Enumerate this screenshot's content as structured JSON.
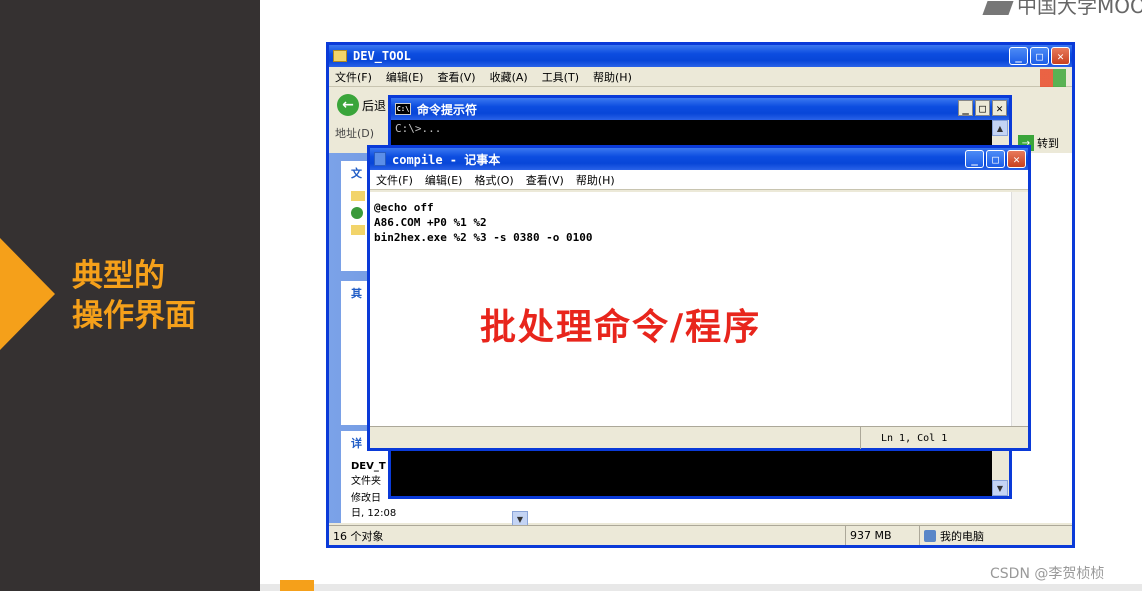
{
  "slide": {
    "heading_line1": "典型的",
    "heading_line2": "操作界面",
    "logo_text": "中国大学MOOC",
    "watermark": "CSDN @李贺桢桢",
    "accent_color": "#f5a01a"
  },
  "explorer": {
    "title": "DEV_TOOL",
    "menu": [
      "文件(F)",
      "编辑(E)",
      "查看(V)",
      "收藏(A)",
      "工具(T)",
      "帮助(H)"
    ],
    "back_label": "后退",
    "address_label": "地址(D)",
    "goto_label": "转到",
    "left_tasks": [
      "文",
      "其",
      "详"
    ],
    "details": {
      "name": "DEV_T",
      "type": "文件夹",
      "modified_label": "修改日",
      "modified_time": "日, 12:08"
    },
    "status": {
      "objects": "16 个对象",
      "size": "937 MB",
      "location": "我的电脑"
    }
  },
  "cmd": {
    "title": "命令提示符",
    "icon_text": "C:\\",
    "prompt": "C:\\>..."
  },
  "notepad": {
    "title": "compile - 记事本",
    "menu": [
      "文件(F)",
      "编辑(E)",
      "格式(O)",
      "查看(V)",
      "帮助(H)"
    ],
    "lines": [
      "@echo off",
      "A86.COM +P0 %1 %2",
      "bin2hex.exe %2 %3 -s 0380 -o 0100"
    ],
    "status_position": "Ln 1, Col 1"
  },
  "annotation": {
    "text": "批处理命令/程序",
    "color": "#e8251c"
  }
}
